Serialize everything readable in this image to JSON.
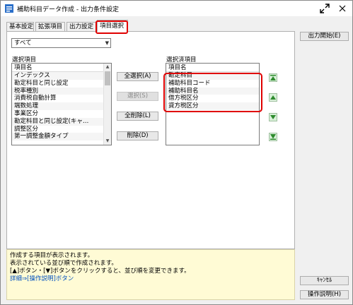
{
  "window": {
    "title": "補助科目データ作成 - 出力条件設定"
  },
  "tabs": [
    "基本設定",
    "拡張項目",
    "出力設定",
    "項目選択"
  ],
  "combo": {
    "value": "すべて"
  },
  "available": {
    "label": "選択項目",
    "header": "項目名",
    "items": [
      "インデックス",
      "勘定科目と同じ設定",
      "税率種別",
      "消費税自動計算",
      "端数処理",
      "事業区分",
      "勘定科目と同じ設定(キャ…",
      "調整区分",
      "第一調整金額タイプ"
    ]
  },
  "selected": {
    "label": "選択済項目",
    "header": "項目名",
    "items": [
      "勘定科目",
      "補助科目コード",
      "補助科目名",
      "借方税区分",
      "貸方税区分"
    ]
  },
  "buttons": {
    "select_all": "全選択(A)",
    "select": "選択(S)",
    "clear_all": "全削除(L)",
    "delete": "削除(D)",
    "output_start": "出力開始(E)",
    "cancel": "ｷｬﾝｾﾙ",
    "help": "操作説明(H)"
  },
  "description": {
    "line1": "作成する項目が表示されます。",
    "line2": "表示されている並び順で作成されます。",
    "line3": "[▲]ボタン・[▼]ボタンをクリックすると、並び順を変更できます。",
    "line4": "詳細⇒[操作説明]ボタン"
  },
  "colors": {
    "highlight": "#e00000",
    "desc_bg": "#fffbd5",
    "arrow_green": "#2e8b2e"
  }
}
